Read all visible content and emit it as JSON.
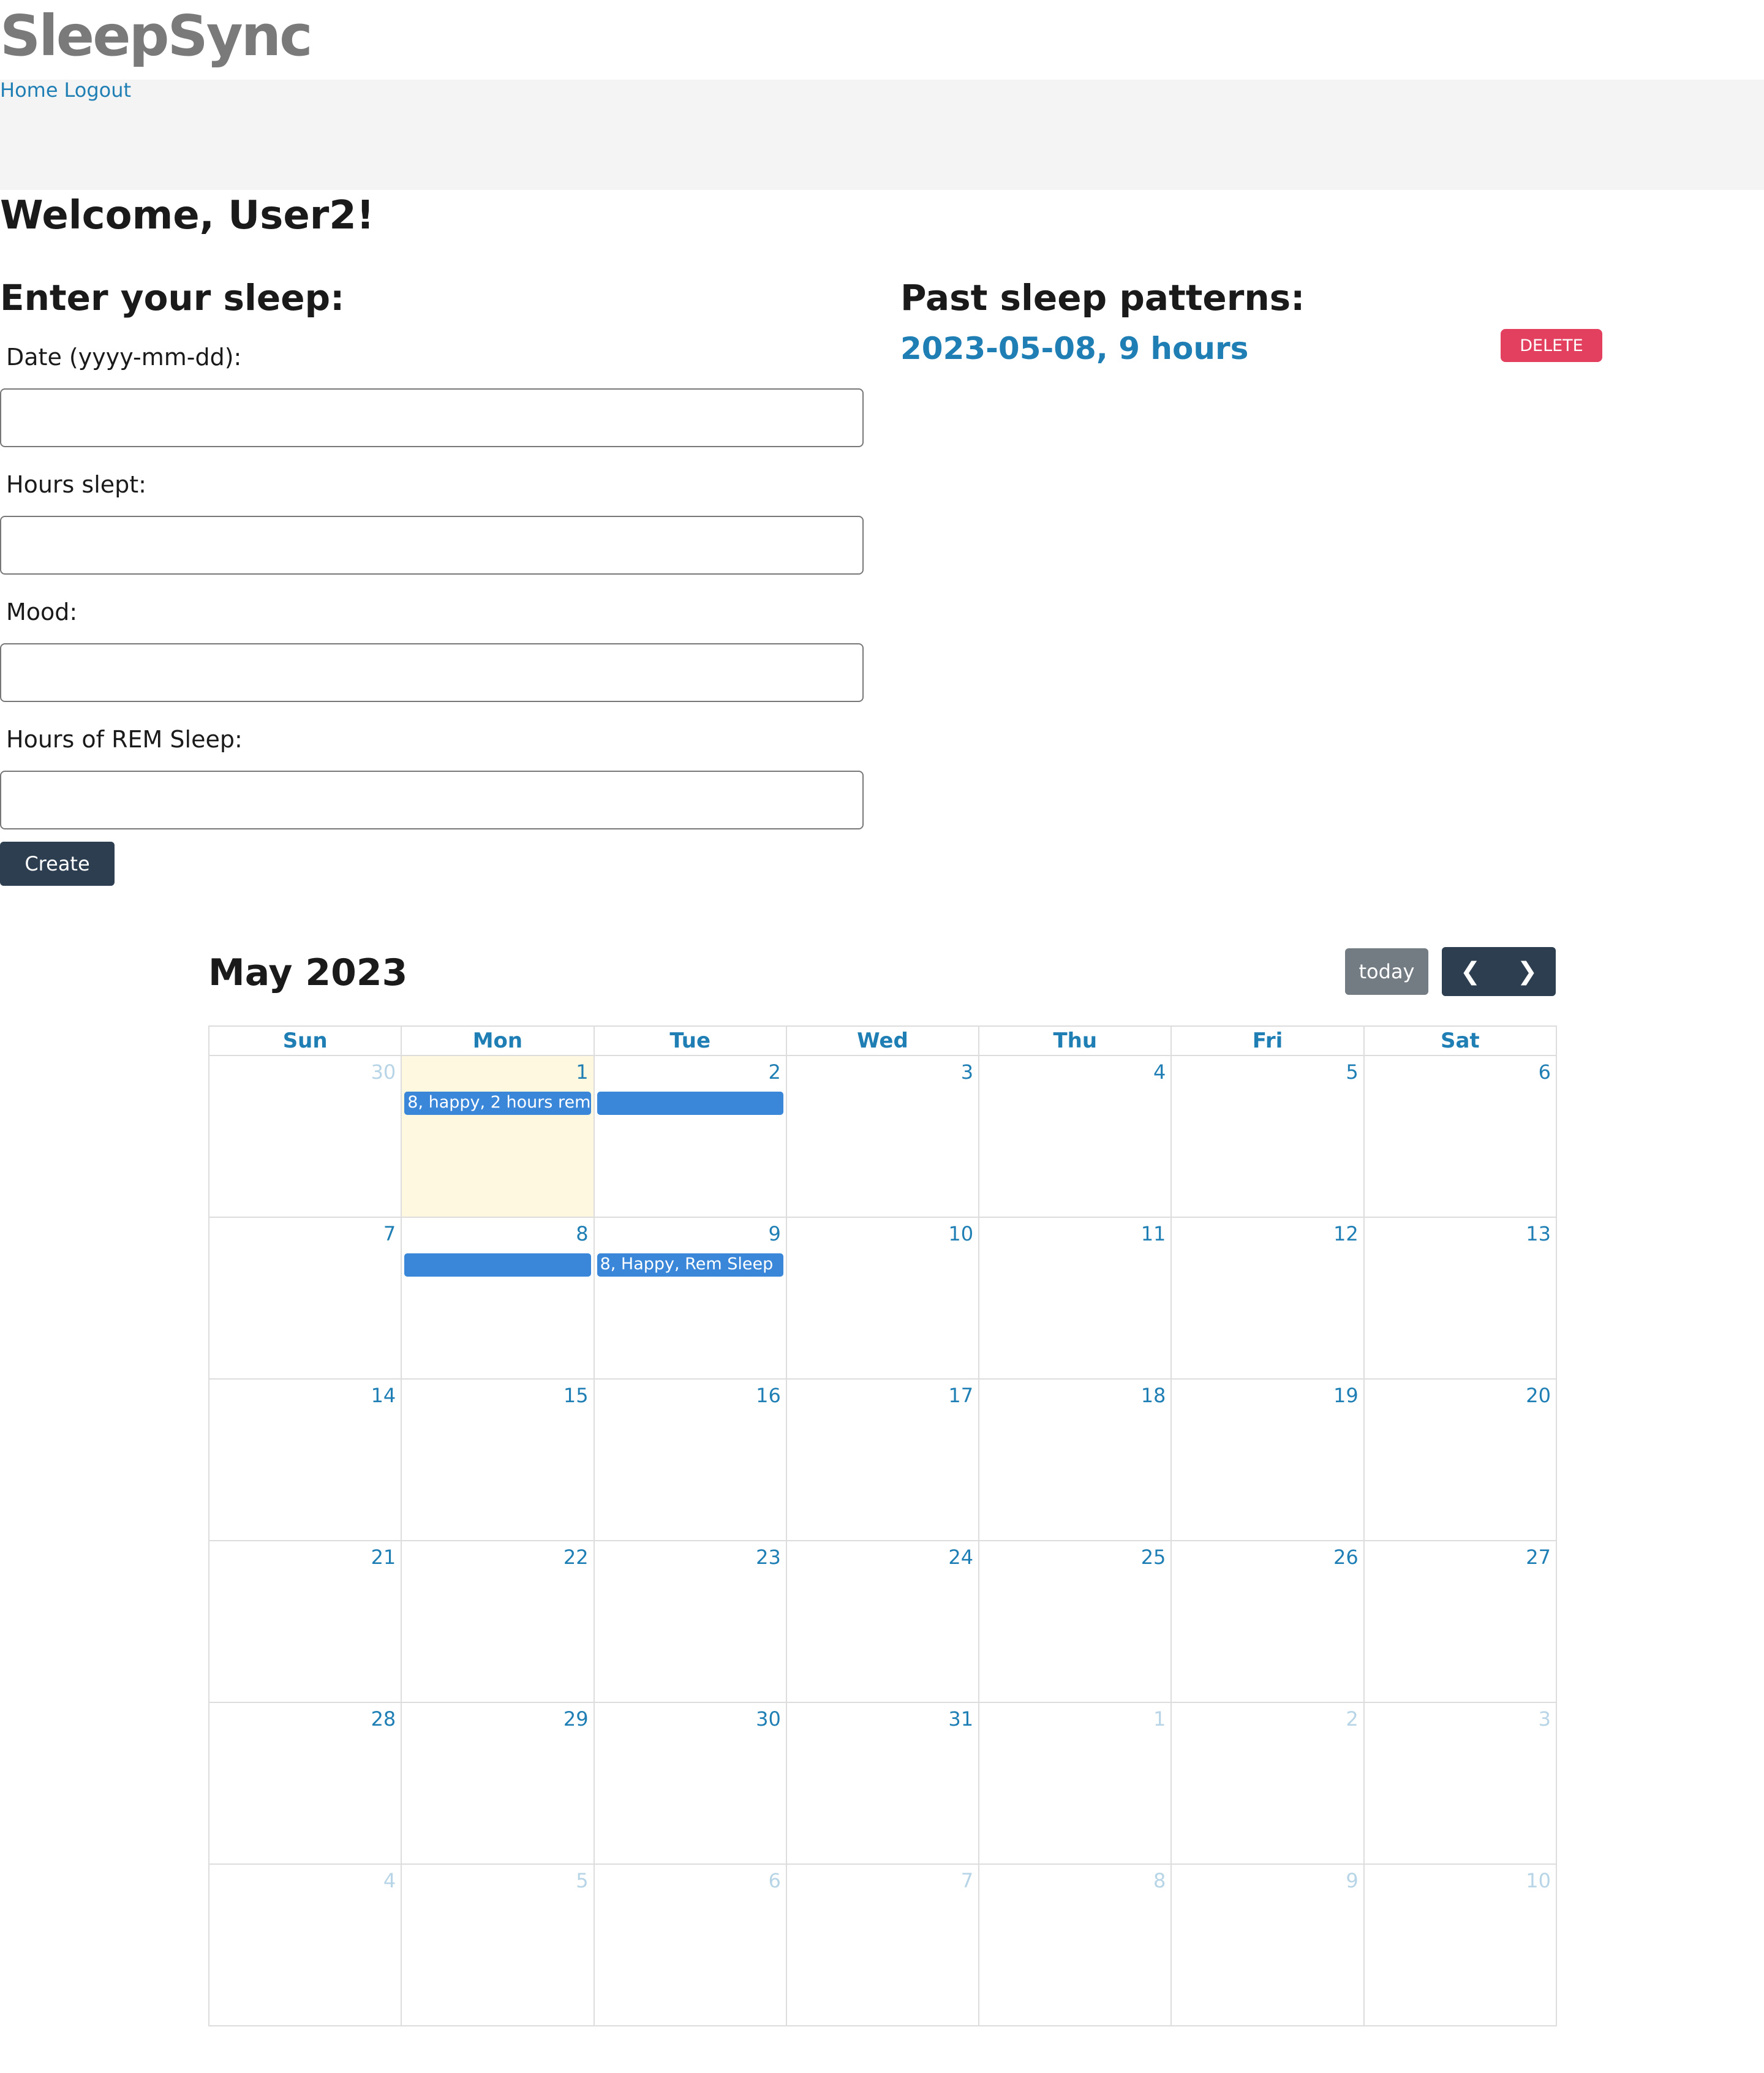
{
  "app": {
    "logo": "SleepSync"
  },
  "nav": {
    "home": "Home",
    "logout": "Logout"
  },
  "welcome": "Welcome, User2!",
  "form": {
    "title": "Enter your sleep:",
    "date_label": "Date (yyyy-mm-dd):",
    "date_value": "",
    "hours_label": "Hours slept:",
    "hours_value": "",
    "mood_label": "Mood:",
    "mood_value": "",
    "rem_label": "Hours of REM Sleep:",
    "rem_value": "",
    "create_label": "Create"
  },
  "past": {
    "title": "Past sleep patterns:",
    "entries": [
      {
        "text": "2023-05-08, 9 hours",
        "delete_label": "DELETE"
      }
    ]
  },
  "calendar": {
    "title": "May 2023",
    "today_label": "today",
    "prev_icon": "chevron-left-icon",
    "next_icon": "chevron-right-icon",
    "dow": [
      "Sun",
      "Mon",
      "Tue",
      "Wed",
      "Thu",
      "Fri",
      "Sat"
    ],
    "weeks": [
      [
        "30",
        "1",
        "2",
        "3",
        "4",
        "5",
        "6"
      ],
      [
        "7",
        "8",
        "9",
        "10",
        "11",
        "12",
        "13"
      ],
      [
        "14",
        "15",
        "16",
        "17",
        "18",
        "19",
        "20"
      ],
      [
        "21",
        "22",
        "23",
        "24",
        "25",
        "26",
        "27"
      ],
      [
        "28",
        "29",
        "30",
        "31",
        "1",
        "2",
        "3"
      ],
      [
        "4",
        "5",
        "6",
        "7",
        "8",
        "9",
        "10"
      ]
    ],
    "events": [
      {
        "week": 0,
        "day": 1,
        "text": "8, happy, 2 hours rem"
      },
      {
        "week": 0,
        "day": 2,
        "text": ""
      },
      {
        "week": 1,
        "day": 1,
        "text": ""
      },
      {
        "week": 1,
        "day": 2,
        "text": "8, Happy, Rem Sleep"
      }
    ],
    "today": {
      "week": 0,
      "day": 1
    }
  },
  "colors": {
    "accent": "#1f7fb4",
    "event": "#3a87d9",
    "dark": "#2c3e50",
    "danger": "#e2405e",
    "today_bg": "#fef8e0"
  }
}
